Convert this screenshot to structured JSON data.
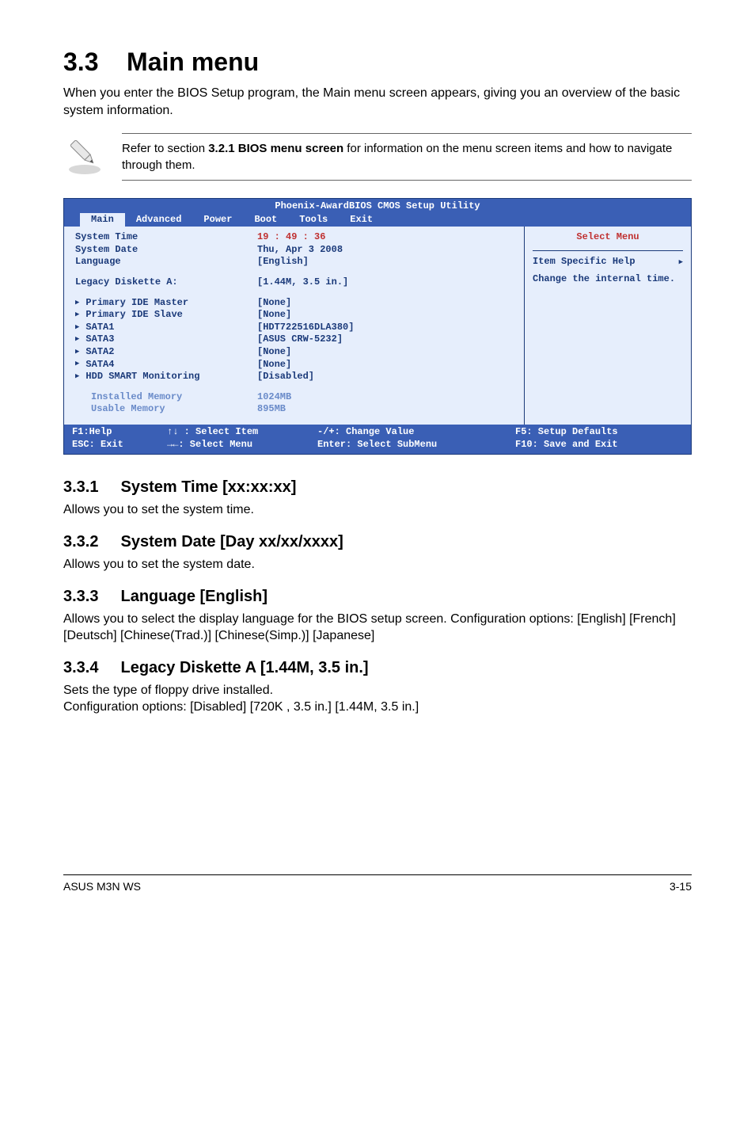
{
  "h1": {
    "num": "3.3",
    "title": "Main menu"
  },
  "intro": "When you enter the BIOS Setup program, the Main menu screen appears, giving you an overview of the basic system information.",
  "note": {
    "pre": "Refer to section ",
    "bold": "3.2.1 BIOS menu screen",
    "post": " for information on the menu screen items and how to navigate through them."
  },
  "bios": {
    "brand": "Phoenix-AwardBIOS CMOS Setup Utility",
    "tabs": [
      "Main",
      "Advanced",
      "Power",
      "Boot",
      "Tools",
      "Exit"
    ],
    "selected_tab": "Main",
    "rows_top": [
      {
        "label": "System Time",
        "value": "19 : 49 : 36",
        "red_value": true
      },
      {
        "label": "System Date",
        "value": "Thu, Apr  3 2008"
      },
      {
        "label": "Language",
        "value": "[English]"
      }
    ],
    "legacy": {
      "label": "Legacy Diskette A:",
      "value": "[1.44M, 3.5 in.]"
    },
    "subs": [
      {
        "label": "Primary IDE Master",
        "value": "[None]"
      },
      {
        "label": "Primary IDE Slave",
        "value": "[None]"
      },
      {
        "label": "SATA1",
        "value": "[HDT722516DLA380]"
      },
      {
        "label": "SATA3",
        "value": "[ASUS    CRW-5232]"
      },
      {
        "label": "SATA2",
        "value": "[None]"
      },
      {
        "label": "SATA4",
        "value": "[None]"
      },
      {
        "label": "HDD SMART Monitoring",
        "value": "[Disabled]"
      }
    ],
    "info": [
      {
        "label": "Installed Memory",
        "value": "1024MB"
      },
      {
        "label": "Usable Memory",
        "value": " 895MB"
      }
    ],
    "right": {
      "select_menu": "Select Menu",
      "help_title": "Item Specific Help",
      "help_body": "Change the internal time."
    },
    "footer": {
      "r1": {
        "c1": "F1:Help",
        "c2": "↑↓ : Select Item",
        "c3": "-/+: Change Value",
        "c4": "F5: Setup Defaults"
      },
      "r2": {
        "c1": "ESC: Exit",
        "c2": "→←: Select Menu",
        "c3": "Enter: Select SubMenu",
        "c4": "F10: Save and Exit"
      }
    }
  },
  "sections": {
    "s331": {
      "num": "3.3.1",
      "title": "System Time [xx:xx:xx]",
      "body": "Allows you to set the system time."
    },
    "s332": {
      "num": "3.3.2",
      "title": "System Date [Day xx/xx/xxxx]",
      "body": "Allows you to set the system date."
    },
    "s333": {
      "num": "3.3.3",
      "title": "Language [English]",
      "body": "Allows you to select the display language for the BIOS setup screen. Configuration options: [English] [French] [Deutsch] [Chinese(Trad.)] [Chinese(Simp.)] [Japanese]"
    },
    "s334": {
      "num": "3.3.4",
      "title": "Legacy Diskette A [1.44M, 3.5 in.]",
      "body": "Sets the type of floppy drive installed.\nConfiguration options: [Disabled] [720K , 3.5 in.] [1.44M, 3.5 in.]"
    }
  },
  "footer": {
    "left": "ASUS M3N WS",
    "right": "3-15"
  }
}
